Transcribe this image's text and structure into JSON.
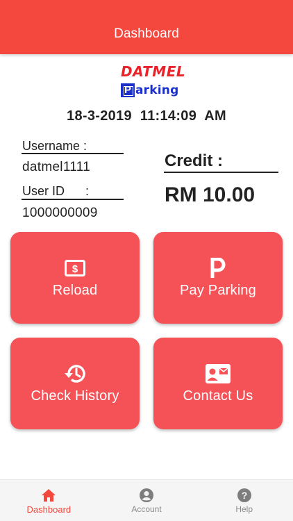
{
  "header": {
    "title": "Dashboard"
  },
  "logo": {
    "top_text": "DATMEL",
    "p_letter": "P",
    "bottom_text": "arking"
  },
  "datetime": "18-3-2019  11:14:09 AM",
  "user": {
    "username_label": "Username :",
    "username_value": "datmel1111",
    "userid_label": "User ID      :",
    "userid_value": "1000000009"
  },
  "credit": {
    "label": "Credit :",
    "value": "RM 10.00"
  },
  "tiles": [
    {
      "label": "Reload",
      "icon": "dollar-card-icon"
    },
    {
      "label": "Pay Parking",
      "icon": "parking-p-icon"
    },
    {
      "label": "Check History",
      "icon": "history-icon"
    },
    {
      "label": "Contact Us",
      "icon": "contact-card-icon"
    }
  ],
  "nav": [
    {
      "label": "Dashboard",
      "icon": "home-icon",
      "active": true
    },
    {
      "label": "Account",
      "icon": "account-circle-icon",
      "active": false
    },
    {
      "label": "Help",
      "icon": "help-circle-icon",
      "active": false
    }
  ],
  "colors": {
    "accent": "#f4473d",
    "tile": "#f55258",
    "logo_red": "#e8232a",
    "logo_blue": "#1a30c9",
    "nav_inactive": "#8a8a8a"
  }
}
